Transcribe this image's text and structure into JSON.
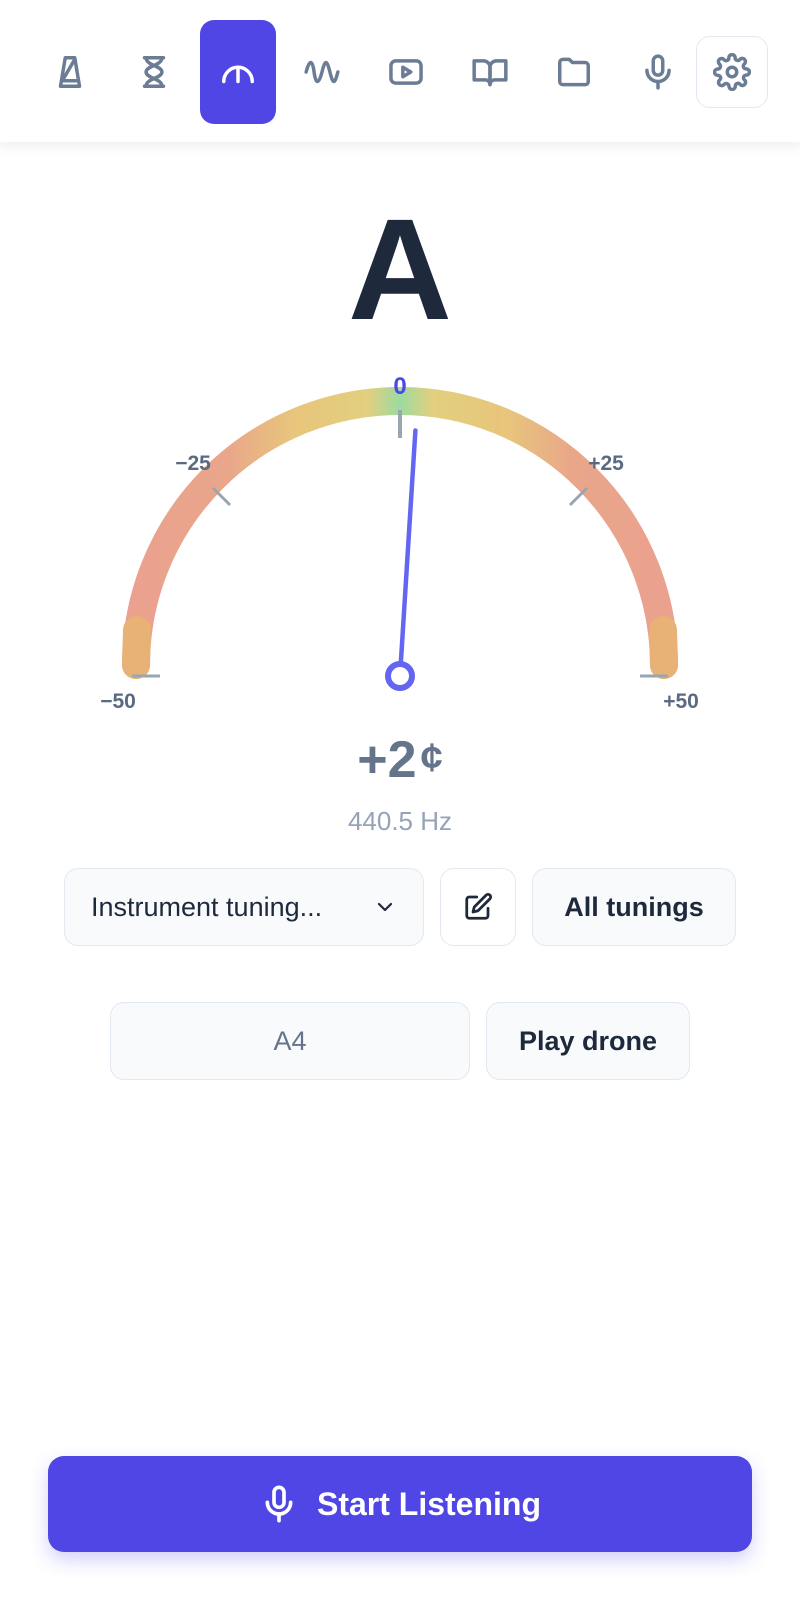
{
  "nav": {
    "items": [
      {
        "icon": "metronome-icon",
        "label": "Metronome",
        "active": false
      },
      {
        "icon": "hourglass-icon",
        "label": "Timer",
        "active": false
      },
      {
        "icon": "tuner-gauge-icon",
        "label": "Tuner",
        "active": true
      },
      {
        "icon": "wave-icon",
        "label": "Tone generator",
        "active": false
      },
      {
        "icon": "video-icon",
        "label": "Video",
        "active": false
      },
      {
        "icon": "book-icon",
        "label": "Library",
        "active": false
      },
      {
        "icon": "folder-icon",
        "label": "Files",
        "active": false
      },
      {
        "icon": "microphone-icon",
        "label": "Recorder",
        "active": false
      },
      {
        "icon": "gear-icon",
        "label": "Settings",
        "active": false
      }
    ],
    "accent": "#4f46e5"
  },
  "tuner": {
    "note": "A",
    "cents_value": "+2",
    "cents_unit": "¢",
    "frequency": "440.5 Hz",
    "needle_cents": 2,
    "scale": {
      "min": -50,
      "max": 50,
      "labels": {
        "minus50": "−50",
        "minus25": "−25",
        "zero": "0",
        "plus25": "+25",
        "plus50": "+50"
      }
    },
    "colors": {
      "in_tune": "#9dd9a0",
      "near": "#e7c97a",
      "off": "#e99c95",
      "needle": "#6366f1"
    }
  },
  "controls": {
    "tuning_select": "Instrument tuning...",
    "edit_icon": "edit-icon",
    "all_tunings": "All tunings",
    "drone_note": "A4",
    "play_drone": "Play drone"
  },
  "start": {
    "label": "Start Listening",
    "icon": "microphone-icon"
  }
}
